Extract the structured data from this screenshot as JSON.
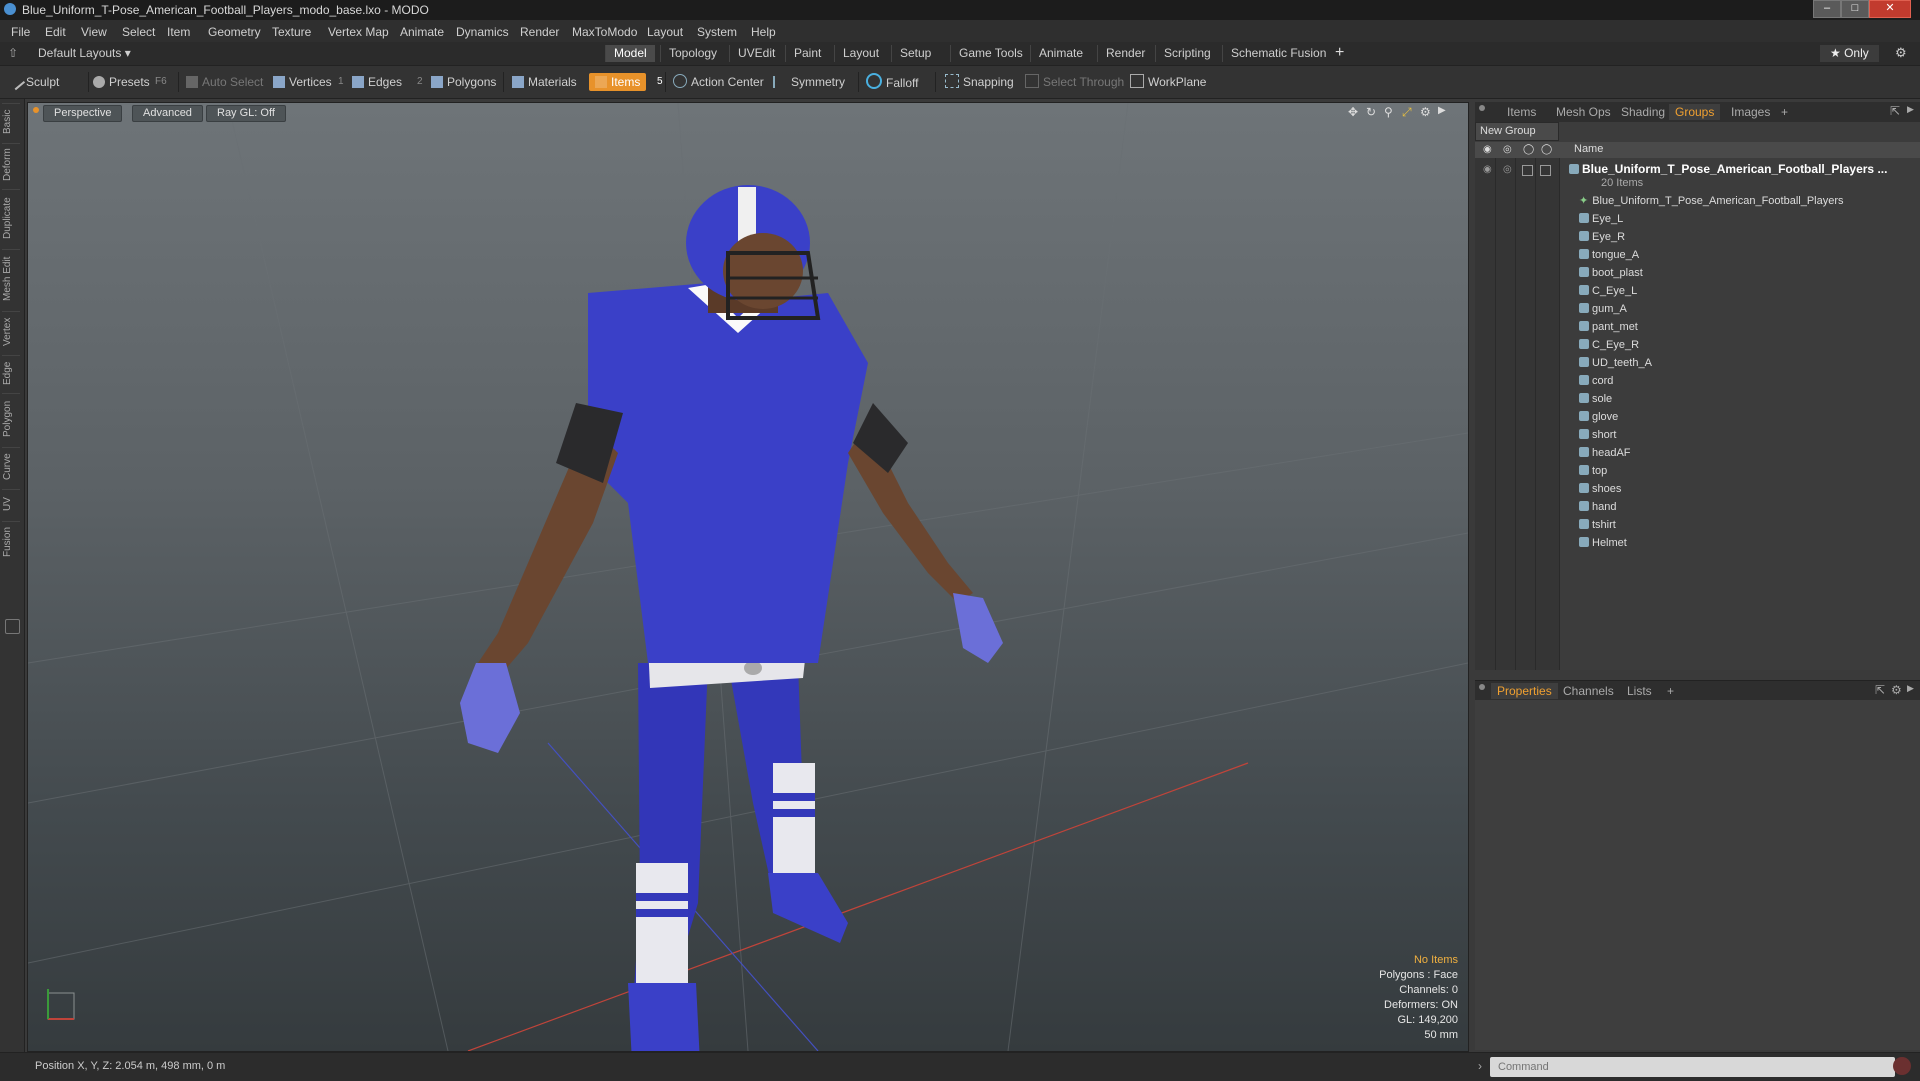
{
  "window": {
    "title": "Blue_Uniform_T-Pose_American_Football_Players_modo_base.lxo - MODO"
  },
  "menu": [
    "File",
    "Edit",
    "View",
    "Select",
    "Item",
    "Geometry",
    "Texture",
    "Vertex Map",
    "Animate",
    "Dynamics",
    "Render",
    "MaxToModo",
    "Layout",
    "System",
    "Help"
  ],
  "layoutbar": {
    "layout_dropdown": "Default Layouts ▾",
    "tabs": [
      "Model",
      "Topology",
      "UVEdit",
      "Paint",
      "Layout",
      "Setup",
      "Game Tools",
      "Animate",
      "Render",
      "Scripting",
      "Schematic Fusion"
    ],
    "active_tab": "Model",
    "add": "+",
    "only": "★ Only"
  },
  "toolbar": {
    "sculpt": "Sculpt",
    "presets": "Presets",
    "presets_key": "F6",
    "auto_select": "Auto Select",
    "vertices": "Vertices",
    "vertices_key": "1",
    "edges": "Edges",
    "edges_key": "2",
    "polygons": "Polygons",
    "materials": "Materials",
    "items": "Items",
    "items_key": "5",
    "action_center": "Action Center",
    "symmetry": "Symmetry",
    "falloff": "Falloff",
    "snapping": "Snapping",
    "select_through": "Select Through",
    "workplane": "WorkPlane"
  },
  "leftstrip": [
    "Basic",
    "Deform",
    "Duplicate",
    "Mesh Edit",
    "Vertex",
    "Edge",
    "Polygon",
    "Curve",
    "UV",
    "Fusion"
  ],
  "viewport": {
    "view": "Perspective",
    "shading": "Advanced",
    "raygl": "Ray GL: Off",
    "info": {
      "selection": "No Items",
      "polygons": "Polygons : Face",
      "channels": "Channels: 0",
      "deformers": "Deformers: ON",
      "gl": "GL: 149,200",
      "focal": "50 mm"
    }
  },
  "groups_panel": {
    "tabs": [
      "Items",
      "Mesh Ops",
      "Shading",
      "Groups",
      "Images"
    ],
    "active_tab": "Groups",
    "add": "+",
    "new_group": "New Group",
    "name_col": "Name",
    "root": {
      "label": "Blue_Uniform_T_Pose_American_Football_Players ...",
      "count": "20 Items"
    },
    "children": [
      "Blue_Uniform_T_Pose_American_Football_Players",
      "Eye_L",
      "Eye_R",
      "tongue_A",
      "boot_plast",
      "C_Eye_L",
      "gum_A",
      "pant_met",
      "C_Eye_R",
      "UD_teeth_A",
      "cord",
      "sole",
      "glove",
      "short",
      "headAF",
      "top",
      "shoes",
      "hand",
      "tshirt",
      "Helmet"
    ]
  },
  "properties_panel": {
    "tabs": [
      "Properties",
      "Channels",
      "Lists"
    ],
    "active_tab": "Properties",
    "add": "+"
  },
  "status": {
    "position": "Position X, Y, Z:  2.054 m, 498 mm, 0 m",
    "command_placeholder": "Command"
  },
  "colors": {
    "accent": "#e8922a",
    "uniform": "#3a3fc0",
    "tab_highlight": "#f0a030"
  }
}
